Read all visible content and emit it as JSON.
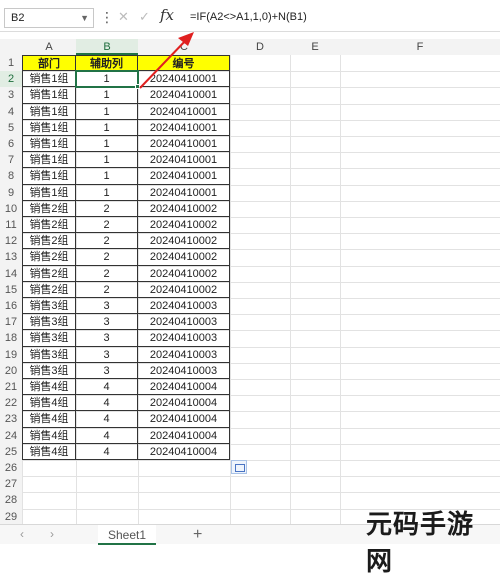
{
  "formula_bar": {
    "name_box": "B2",
    "fx_label": "fx",
    "formula": "=IF(A2<>A1,1,0)+N(B1)"
  },
  "columns": [
    "A",
    "B",
    "C",
    "D",
    "E",
    "F"
  ],
  "selected_cell": "B2",
  "table": {
    "headers": [
      "部门",
      "辅助列",
      "编号"
    ],
    "rows": [
      [
        "销售1组",
        "1",
        "20240410001"
      ],
      [
        "销售1组",
        "1",
        "20240410001"
      ],
      [
        "销售1组",
        "1",
        "20240410001"
      ],
      [
        "销售1组",
        "1",
        "20240410001"
      ],
      [
        "销售1组",
        "1",
        "20240410001"
      ],
      [
        "销售1组",
        "1",
        "20240410001"
      ],
      [
        "销售1组",
        "1",
        "20240410001"
      ],
      [
        "销售1组",
        "1",
        "20240410001"
      ],
      [
        "销售2组",
        "2",
        "20240410002"
      ],
      [
        "销售2组",
        "2",
        "20240410002"
      ],
      [
        "销售2组",
        "2",
        "20240410002"
      ],
      [
        "销售2组",
        "2",
        "20240410002"
      ],
      [
        "销售2组",
        "2",
        "20240410002"
      ],
      [
        "销售2组",
        "2",
        "20240410002"
      ],
      [
        "销售3组",
        "3",
        "20240410003"
      ],
      [
        "销售3组",
        "3",
        "20240410003"
      ],
      [
        "销售3组",
        "3",
        "20240410003"
      ],
      [
        "销售3组",
        "3",
        "20240410003"
      ],
      [
        "销售3组",
        "3",
        "20240410003"
      ],
      [
        "销售4组",
        "4",
        "20240410004"
      ],
      [
        "销售4组",
        "4",
        "20240410004"
      ],
      [
        "销售4组",
        "4",
        "20240410004"
      ],
      [
        "销售4组",
        "4",
        "20240410004"
      ],
      [
        "销售4组",
        "4",
        "20240410004"
      ]
    ]
  },
  "row_numbers": [
    "1",
    "2",
    "3",
    "4",
    "5",
    "6",
    "7",
    "8",
    "9",
    "10",
    "11",
    "12",
    "13",
    "14",
    "15",
    "16",
    "17",
    "18",
    "19",
    "20",
    "21",
    "22",
    "23",
    "24",
    "25",
    "26",
    "27",
    "28",
    "29"
  ],
  "sheet_tabs": {
    "active": "Sheet1",
    "add_label": "+"
  },
  "watermark": "元码手游网",
  "colors": {
    "header_fill": "#ffff00",
    "selection": "#217346",
    "annotation_arrow": "#e02020"
  }
}
